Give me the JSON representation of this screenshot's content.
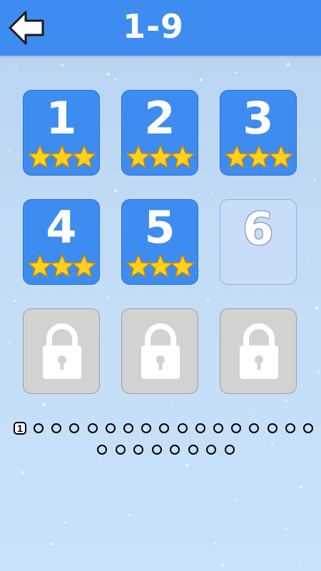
{
  "header": {
    "title": "1-9"
  },
  "levels": [
    {
      "number": "1",
      "status": "completed",
      "stars": 3
    },
    {
      "number": "2",
      "status": "completed",
      "stars": 3
    },
    {
      "number": "3",
      "status": "completed",
      "stars": 3
    },
    {
      "number": "4",
      "status": "completed",
      "stars": 3
    },
    {
      "number": "5",
      "status": "completed",
      "stars": 3
    },
    {
      "number": "6",
      "status": "current",
      "stars": 0
    },
    {
      "number": "",
      "status": "locked",
      "stars": 0
    },
    {
      "number": "",
      "status": "locked",
      "stars": 0
    },
    {
      "number": "",
      "status": "locked",
      "stars": 0
    }
  ],
  "pagination": {
    "current_page": "1",
    "total_pages": 25
  },
  "colors": {
    "header": "#3e8cf0",
    "tile_completed": "#3e8cf0",
    "tile_current": "#c9ddfb",
    "tile_locked": "#d2d2d2",
    "star": "#ffd21f",
    "background": "#c4ddf7"
  }
}
